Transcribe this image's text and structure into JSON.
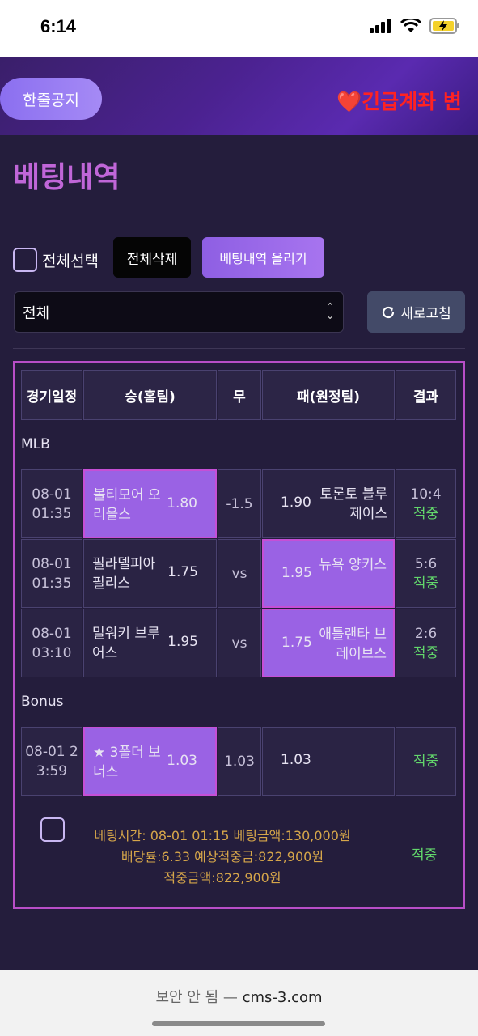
{
  "status_bar": {
    "time": "6:14"
  },
  "notice": {
    "button_label": "한줄공지",
    "marquee_heart": "❤️",
    "marquee_text": "긴급계좌 변"
  },
  "page": {
    "title": "베팅내역",
    "select_all_label": "전체선택",
    "delete_all_label": "전체삭제",
    "upload_label": "베팅내역 올리기",
    "filter_value": "전체",
    "refresh_label": "새로고침"
  },
  "table": {
    "headers": [
      "경기일정",
      "승(홈팀)",
      "무",
      "패(원정팀)",
      "결과"
    ],
    "sections": [
      {
        "label": "MLB",
        "rows": [
          {
            "date": "08-01",
            "time": "01:35",
            "home": "볼티모어 오리올스",
            "home_odds": "1.80",
            "draw": "-1.5",
            "away_odds": "1.90",
            "away": "토론토 블루제이스",
            "score": "10:4",
            "result": "적중",
            "pick": "home"
          },
          {
            "date": "08-01",
            "time": "01:35",
            "home": "필라델피아 필리스",
            "home_odds": "1.75",
            "draw": "vs",
            "away_odds": "1.95",
            "away": "뉴욕 양키스",
            "score": "5:6",
            "result": "적중",
            "pick": "away"
          },
          {
            "date": "08-01",
            "time": "03:10",
            "home": "밀워키 브루어스",
            "home_odds": "1.95",
            "draw": "vs",
            "away_odds": "1.75",
            "away": "애틀랜타 브레이브스",
            "score": "2:6",
            "result": "적중",
            "pick": "away"
          }
        ]
      },
      {
        "label": "Bonus",
        "rows": [
          {
            "date": "08-01 2",
            "time": "3:59",
            "home": "★ 3폴더 보너스",
            "home_odds": "1.03",
            "draw": "1.03",
            "away_odds": "1.03",
            "away": "",
            "score": "",
            "result": "적중",
            "pick": "home"
          }
        ]
      }
    ],
    "summary": {
      "line1": "베팅시간: 08-01 01:15    베팅금액:130,000원",
      "line2": "배당률:6.33    예상적중금:822,900원",
      "line3": "적중금액:822,900원",
      "result": "적중"
    }
  },
  "browser": {
    "insecure_label": "보안 안 됨 —",
    "domain": "cms-3.com"
  },
  "colors": {
    "accent": "#c066d8",
    "highlight": "#9a62e4",
    "win": "#62d66b",
    "summary": "#d6a64a"
  }
}
